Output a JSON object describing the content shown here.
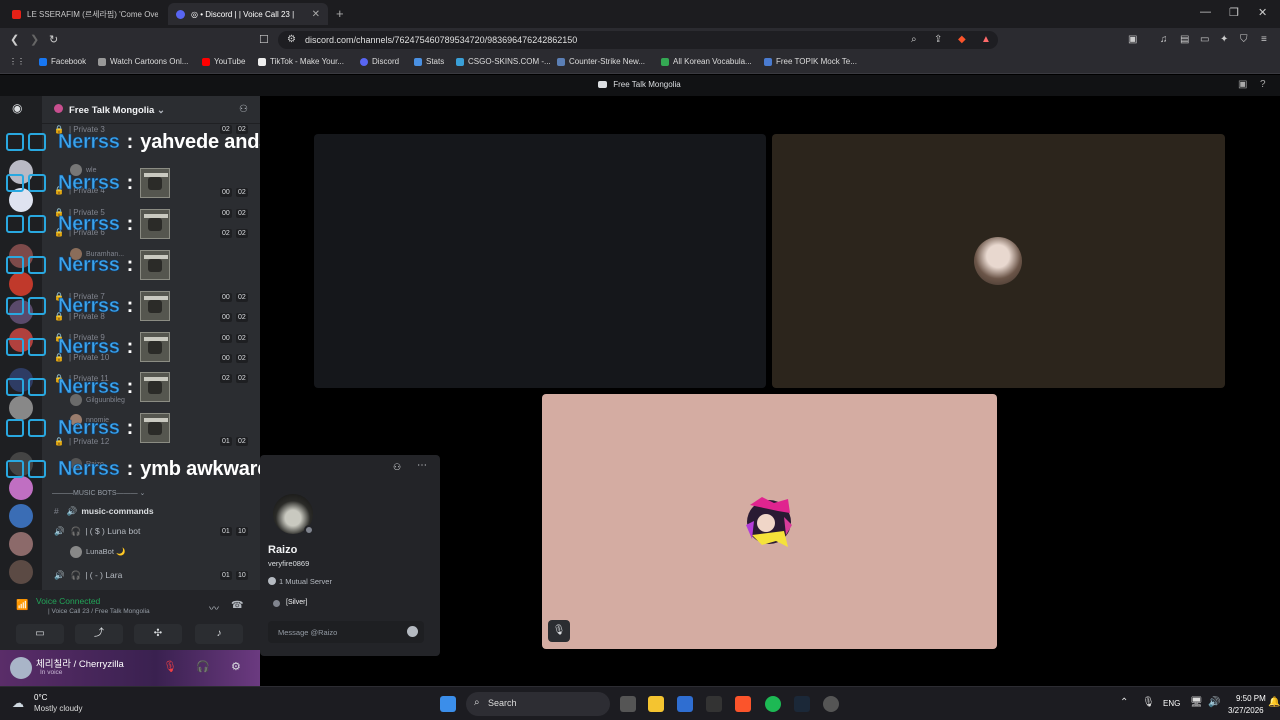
{
  "browser": {
    "tabs": [
      {
        "label": "LE SSERAFIM (르세라핌) 'Come Over'",
        "color": "#e62117"
      },
      {
        "label": "◎ • Discord | | Voice Call 23 |",
        "color": "#5865f2"
      }
    ],
    "url": "discord.com/channels/762475460789534720/983696476242862150",
    "bookmarks": [
      {
        "label": "Facebook",
        "color": "#1877f2"
      },
      {
        "label": "Watch Cartoons Onl...",
        "color": "#999999"
      },
      {
        "label": "YouTube",
        "color": "#ff0000"
      },
      {
        "label": "TikTok - Make Your...",
        "color": "#ffffff"
      },
      {
        "label": "Discord",
        "color": "#5865f2"
      },
      {
        "label": "Stats",
        "color": "#4a90e2"
      },
      {
        "label": "CSGO-SKINS.COM -...",
        "color": "#3aa0d8"
      },
      {
        "label": "Counter-Strike New...",
        "color": "#5b7fb5"
      },
      {
        "label": "All Korean Vocabula...",
        "color": "#34a853"
      },
      {
        "label": "Free TOPIK Mock Te...",
        "color": "#4a7bd0"
      }
    ]
  },
  "discord": {
    "window_title": "Free Talk Mongolia",
    "server_name": "Free Talk Mongolia",
    "channels": [
      {
        "label": "| Private 3",
        "badge1": "02",
        "badge2": "02"
      },
      {
        "label": "| Private 4",
        "badge1": "00",
        "badge2": "02"
      },
      {
        "label": "| Private 5",
        "badge1": "00",
        "badge2": "02"
      },
      {
        "label": "| Private 6",
        "badge1": "02",
        "badge2": "02"
      },
      {
        "label": "| Private 7",
        "badge1": "00",
        "badge2": "02"
      },
      {
        "label": "| Private 8",
        "badge1": "00",
        "badge2": "02"
      },
      {
        "label": "| Private 9",
        "badge1": "00",
        "badge2": "02"
      },
      {
        "label": "| Private 10",
        "badge1": "00",
        "badge2": "02"
      },
      {
        "label": "| Private 11",
        "badge1": "02",
        "badge2": "02"
      },
      {
        "label": "| Private 12",
        "badge1": "01",
        "badge2": "02"
      }
    ],
    "members": [
      "wle",
      "Buramhan...",
      "Gilguunbileg",
      "nnomie",
      "Raizo"
    ],
    "music_category": "MUSIC BOTS",
    "music_commands": "music-commands",
    "luna_bot": "| ( $ ) Luna bot",
    "luna_badge1": "01",
    "luna_badge2": "10",
    "lunabot_member": "LunaBot 🌙",
    "lara": "| ( - ) Lara",
    "lara_badge1": "01",
    "lara_badge2": "10",
    "voice_status": "Voice Connected",
    "voice_channel": "| Voice Call 23 / Free Talk Mongolia",
    "user_name": "체리칠라 / Cherryzilla",
    "user_status": "In voice",
    "profile": {
      "name": "Raizo",
      "handle": "veryfire0869",
      "mutual": "1 Mutual Server",
      "tag": "[Silver]",
      "message_placeholder": "Message @Raizo"
    },
    "tiles": [
      {
        "bg": "#15171b"
      },
      {
        "bg": "#2c251c"
      },
      {
        "bg": "#d4aca2"
      }
    ]
  },
  "chat_overlay": [
    {
      "name": "Nerrss",
      "message": "yahvede anda hha",
      "has_emote": false
    },
    {
      "name": "Nerrss",
      "message": "",
      "has_emote": true
    },
    {
      "name": "Nerrss",
      "message": "",
      "has_emote": true
    },
    {
      "name": "Nerrss",
      "message": "",
      "has_emote": true
    },
    {
      "name": "Nerrss",
      "message": "",
      "has_emote": true
    },
    {
      "name": "Nerrss",
      "message": "",
      "has_emote": true
    },
    {
      "name": "Nerrss",
      "message": "",
      "has_emote": true
    },
    {
      "name": "Nerrss",
      "message": "",
      "has_emote": true
    },
    {
      "name": "Nerrss",
      "message": "ymb awkward ymbe sd",
      "has_emote": false
    }
  ],
  "taskbar": {
    "temperature": "0°C",
    "weather": "Mostly cloudy",
    "search": "Search",
    "language": "ENG",
    "time": "9:50 PM",
    "date": "3/27/2026"
  }
}
